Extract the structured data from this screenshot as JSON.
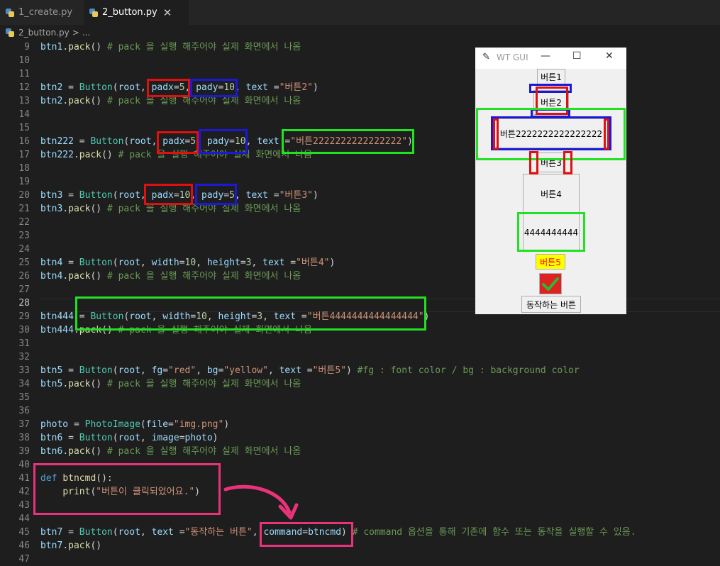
{
  "tabs": [
    {
      "label": "1_create.py"
    },
    {
      "label": "2_button.py",
      "close": "✕"
    }
  ],
  "breadcrumb": {
    "file": "2_button.py",
    "sep": ">",
    "rest": "..."
  },
  "lines": [
    {
      "n": "9",
      "t": [
        [
          "v",
          "btn1"
        ],
        [
          "p",
          "."
        ],
        [
          "f",
          "pack"
        ],
        [
          "p",
          "() "
        ],
        [
          "m",
          "# pack 을 실행 해주어야 실제 화면에서 나옴"
        ]
      ]
    },
    {
      "n": "10",
      "t": []
    },
    {
      "n": "11",
      "t": []
    },
    {
      "n": "12",
      "t": [
        [
          "v",
          "btn2"
        ],
        [
          "p",
          " = "
        ],
        [
          "c",
          "Button"
        ],
        [
          "p",
          "("
        ],
        [
          "v",
          "root"
        ],
        [
          "p",
          ", "
        ],
        [
          "v",
          "padx"
        ],
        [
          "p",
          "="
        ],
        [
          "n",
          "5"
        ],
        [
          "p",
          ", "
        ],
        [
          "v",
          "pady"
        ],
        [
          "p",
          "="
        ],
        [
          "n",
          "10"
        ],
        [
          "p",
          ", "
        ],
        [
          "v",
          "text"
        ],
        [
          "p",
          " ="
        ],
        [
          "s",
          "\"버튼2\""
        ],
        [
          "p",
          ")"
        ]
      ]
    },
    {
      "n": "13",
      "t": [
        [
          "v",
          "btn2"
        ],
        [
          "p",
          "."
        ],
        [
          "f",
          "pack"
        ],
        [
          "p",
          "() "
        ],
        [
          "m",
          "# pack 을 실행 해주어야 실제 화면에서 나옴"
        ]
      ]
    },
    {
      "n": "14",
      "t": []
    },
    {
      "n": "15",
      "t": []
    },
    {
      "n": "16",
      "t": [
        [
          "v",
          "btn222"
        ],
        [
          "p",
          " = "
        ],
        [
          "c",
          "Button"
        ],
        [
          "p",
          "("
        ],
        [
          "v",
          "root"
        ],
        [
          "p",
          ", "
        ],
        [
          "v",
          "padx"
        ],
        [
          "p",
          "="
        ],
        [
          "n",
          "5"
        ],
        [
          "p",
          ", "
        ],
        [
          "v",
          "pady"
        ],
        [
          "p",
          "="
        ],
        [
          "n",
          "10"
        ],
        [
          "p",
          ", "
        ],
        [
          "v",
          "text"
        ],
        [
          "p",
          " ="
        ],
        [
          "s",
          "\"버튼2222222222222222\""
        ],
        [
          "p",
          ")"
        ]
      ]
    },
    {
      "n": "17",
      "t": [
        [
          "v",
          "btn222"
        ],
        [
          "p",
          "."
        ],
        [
          "f",
          "pack"
        ],
        [
          "p",
          "() "
        ],
        [
          "m",
          "# pack 을 실행 해주어야 실제 화면에서 나옴"
        ]
      ]
    },
    {
      "n": "18",
      "t": []
    },
    {
      "n": "19",
      "t": []
    },
    {
      "n": "20",
      "t": [
        [
          "v",
          "btn3"
        ],
        [
          "p",
          " = "
        ],
        [
          "c",
          "Button"
        ],
        [
          "p",
          "("
        ],
        [
          "v",
          "root"
        ],
        [
          "p",
          ", "
        ],
        [
          "v",
          "padx"
        ],
        [
          "p",
          "="
        ],
        [
          "n",
          "10"
        ],
        [
          "p",
          ", "
        ],
        [
          "v",
          "pady"
        ],
        [
          "p",
          "="
        ],
        [
          "n",
          "5"
        ],
        [
          "p",
          ", "
        ],
        [
          "v",
          "text"
        ],
        [
          "p",
          " ="
        ],
        [
          "s",
          "\"버튼3\""
        ],
        [
          "p",
          ")"
        ]
      ]
    },
    {
      "n": "21",
      "t": [
        [
          "v",
          "btn3"
        ],
        [
          "p",
          "."
        ],
        [
          "f",
          "pack"
        ],
        [
          "p",
          "() "
        ],
        [
          "m",
          "# pack 을 실행 해주어야 실제 화면에서 나옴"
        ]
      ]
    },
    {
      "n": "22",
      "t": []
    },
    {
      "n": "23",
      "t": []
    },
    {
      "n": "24",
      "t": []
    },
    {
      "n": "25",
      "t": [
        [
          "v",
          "btn4"
        ],
        [
          "p",
          " = "
        ],
        [
          "c",
          "Button"
        ],
        [
          "p",
          "("
        ],
        [
          "v",
          "root"
        ],
        [
          "p",
          ", "
        ],
        [
          "v",
          "width"
        ],
        [
          "p",
          "="
        ],
        [
          "n",
          "10"
        ],
        [
          "p",
          ", "
        ],
        [
          "v",
          "height"
        ],
        [
          "p",
          "="
        ],
        [
          "n",
          "3"
        ],
        [
          "p",
          ", "
        ],
        [
          "v",
          "text"
        ],
        [
          "p",
          " ="
        ],
        [
          "s",
          "\"버튼4\""
        ],
        [
          "p",
          ")"
        ]
      ]
    },
    {
      "n": "26",
      "t": [
        [
          "v",
          "btn4"
        ],
        [
          "p",
          "."
        ],
        [
          "f",
          "pack"
        ],
        [
          "p",
          "() "
        ],
        [
          "m",
          "# pack 을 실행 해주어야 실제 화면에서 나옴"
        ]
      ]
    },
    {
      "n": "27",
      "t": []
    },
    {
      "n": "28",
      "t": []
    },
    {
      "n": "29",
      "t": [
        [
          "v",
          "btn444"
        ],
        [
          "p",
          " = "
        ],
        [
          "c",
          "Button"
        ],
        [
          "p",
          "("
        ],
        [
          "v",
          "root"
        ],
        [
          "p",
          ", "
        ],
        [
          "v",
          "width"
        ],
        [
          "p",
          "="
        ],
        [
          "n",
          "10"
        ],
        [
          "p",
          ", "
        ],
        [
          "v",
          "height"
        ],
        [
          "p",
          "="
        ],
        [
          "n",
          "3"
        ],
        [
          "p",
          ", "
        ],
        [
          "v",
          "text"
        ],
        [
          "p",
          " ="
        ],
        [
          "s",
          "\"버튼4444444444444444\""
        ],
        [
          "p",
          ")"
        ]
      ]
    },
    {
      "n": "30",
      "t": [
        [
          "v",
          "btn444"
        ],
        [
          "p",
          "."
        ],
        [
          "f",
          "pack"
        ],
        [
          "p",
          "() "
        ],
        [
          "m",
          "# pack 을 실행 해주어야 실제 화면에서 나옴"
        ]
      ]
    },
    {
      "n": "31",
      "t": []
    },
    {
      "n": "32",
      "t": []
    },
    {
      "n": "33",
      "t": [
        [
          "v",
          "btn5"
        ],
        [
          "p",
          " = "
        ],
        [
          "c",
          "Button"
        ],
        [
          "p",
          "("
        ],
        [
          "v",
          "root"
        ],
        [
          "p",
          ", "
        ],
        [
          "v",
          "fg"
        ],
        [
          "p",
          "="
        ],
        [
          "s",
          "\"red\""
        ],
        [
          "p",
          ", "
        ],
        [
          "v",
          "bg"
        ],
        [
          "p",
          "="
        ],
        [
          "s",
          "\"yellow\""
        ],
        [
          "p",
          ", "
        ],
        [
          "v",
          "text"
        ],
        [
          "p",
          " ="
        ],
        [
          "s",
          "\"버튼5\""
        ],
        [
          "p",
          ") "
        ],
        [
          "m",
          "#fg : font color / bg : background color"
        ]
      ]
    },
    {
      "n": "34",
      "t": [
        [
          "v",
          "btn5"
        ],
        [
          "p",
          "."
        ],
        [
          "f",
          "pack"
        ],
        [
          "p",
          "() "
        ],
        [
          "m",
          "# pack 을 실행 해주어야 실제 화면에서 나옴"
        ]
      ]
    },
    {
      "n": "35",
      "t": []
    },
    {
      "n": "36",
      "t": []
    },
    {
      "n": "37",
      "t": [
        [
          "v",
          "photo"
        ],
        [
          "p",
          " = "
        ],
        [
          "c",
          "PhotoImage"
        ],
        [
          "p",
          "("
        ],
        [
          "v",
          "file"
        ],
        [
          "p",
          "="
        ],
        [
          "s",
          "\"img.png\""
        ],
        [
          "p",
          ")"
        ]
      ]
    },
    {
      "n": "38",
      "t": [
        [
          "v",
          "btn6"
        ],
        [
          "p",
          " = "
        ],
        [
          "c",
          "Button"
        ],
        [
          "p",
          "("
        ],
        [
          "v",
          "root"
        ],
        [
          "p",
          ", "
        ],
        [
          "v",
          "image"
        ],
        [
          "p",
          "="
        ],
        [
          "v",
          "photo"
        ],
        [
          "p",
          ")"
        ]
      ]
    },
    {
      "n": "39",
      "t": [
        [
          "v",
          "btn6"
        ],
        [
          "p",
          "."
        ],
        [
          "f",
          "pack"
        ],
        [
          "p",
          "() "
        ],
        [
          "m",
          "# pack 을 실행 해주어야 실제 화면에서 나옴"
        ]
      ]
    },
    {
      "n": "40",
      "t": []
    },
    {
      "n": "41",
      "t": [
        [
          "k",
          "def "
        ],
        [
          "f",
          "btncmd"
        ],
        [
          "p",
          "():"
        ]
      ]
    },
    {
      "n": "42",
      "t": [
        [
          "p",
          "    "
        ],
        [
          "f",
          "print"
        ],
        [
          "p",
          "("
        ],
        [
          "s",
          "\"버튼이 클릭되었어요.\""
        ],
        [
          "p",
          ")"
        ]
      ]
    },
    {
      "n": "43",
      "t": []
    },
    {
      "n": "44",
      "t": []
    },
    {
      "n": "45",
      "t": [
        [
          "v",
          "btn7"
        ],
        [
          "p",
          " = "
        ],
        [
          "c",
          "Button"
        ],
        [
          "p",
          "("
        ],
        [
          "v",
          "root"
        ],
        [
          "p",
          ", "
        ],
        [
          "v",
          "text"
        ],
        [
          "p",
          " ="
        ],
        [
          "s",
          "\"동작하는 버튼\""
        ],
        [
          "p",
          ", "
        ],
        [
          "v",
          "command"
        ],
        [
          "p",
          "="
        ],
        [
          "v",
          "btncmd"
        ],
        [
          "p",
          ") "
        ],
        [
          "m",
          "# command 옵션을 통해 기존에 함수 또는 동작을 실행할 수 있음."
        ]
      ]
    },
    {
      "n": "46",
      "t": [
        [
          "v",
          "btn7"
        ],
        [
          "p",
          "."
        ],
        [
          "f",
          "pack"
        ],
        [
          "p",
          "()"
        ]
      ]
    },
    {
      "n": "47",
      "t": []
    }
  ],
  "current_line": "28",
  "tk_window": {
    "title": "WT GUI",
    "minimize": "—",
    "maximize": "☐",
    "close": "✕",
    "btn1": "버튼1",
    "btn2": "버튼2",
    "btn222": "버튼2222222222222222",
    "btn3": "버튼3",
    "btn4": "버튼4",
    "btn444": "4444444444",
    "btn5": "버튼5",
    "btn5_fg": "#ff0000",
    "btn5_bg": "#ffff00",
    "btn6_icon": "checkmark-icon",
    "btn7": "동작하는 버튼"
  },
  "colors": {
    "annotation_red": "#e01010",
    "annotation_blue": "#1a1ad6",
    "annotation_green": "#22e022",
    "annotation_pink": "#e8337a"
  }
}
